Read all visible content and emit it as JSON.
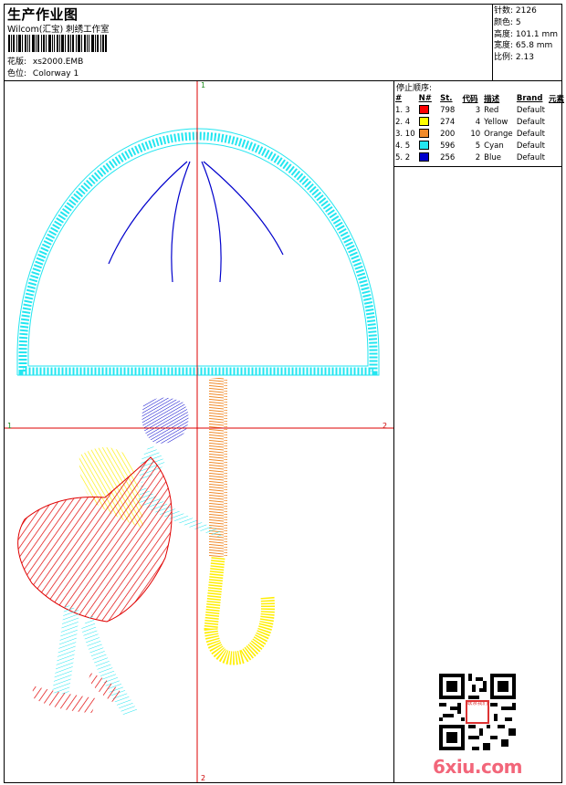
{
  "header": {
    "title": "生产作业图",
    "studio": "Wilcom(汇宝) 刺绣工作室",
    "design_label": "花版:",
    "design_value": "xs2000.EMB",
    "colorway_label": "色位:",
    "colorway_value": "Colorway 1"
  },
  "stats": {
    "stitches": "针数: 2126",
    "colors": "颜色: 5",
    "height": "高度: 101.1 mm",
    "width": "宽度: 65.8 mm",
    "scale": "比例: 2.13"
  },
  "stop_sequence": {
    "title": "停止顺序:",
    "headers": [
      "#",
      "N#",
      "St.",
      "代码",
      "描述",
      "Brand",
      "元素"
    ],
    "rows": [
      {
        "seq": "1. 3",
        "color": "#ff0000",
        "stitches": "798",
        "code": "3",
        "desc": "Red",
        "brand": "Default"
      },
      {
        "seq": "2. 4",
        "color": "#ffff00",
        "stitches": "274",
        "code": "4",
        "desc": "Yellow",
        "brand": "Default"
      },
      {
        "seq": "3. 10",
        "color": "#f08a2a",
        "stitches": "200",
        "code": "10",
        "desc": "Orange",
        "brand": "Default"
      },
      {
        "seq": "4. 5",
        "color": "#22e6f0",
        "stitches": "596",
        "code": "5",
        "desc": "Cyan",
        "brand": "Default"
      },
      {
        "seq": "5. 2",
        "color": "#0000cc",
        "stitches": "256",
        "code": "2",
        "desc": "Blue",
        "brand": "Default"
      }
    ]
  },
  "axes": {
    "top": "1",
    "left": "1",
    "right": "2",
    "bottom": "2"
  },
  "watermark": "6xiu.com",
  "qr_stamp": "联系我们",
  "colors": {
    "red_axis": "#dd0000",
    "cyan": "#22e6f0",
    "red": "#e00000",
    "yellow": "#ffee00",
    "orange": "#f08a2a",
    "blue": "#0000cc"
  }
}
